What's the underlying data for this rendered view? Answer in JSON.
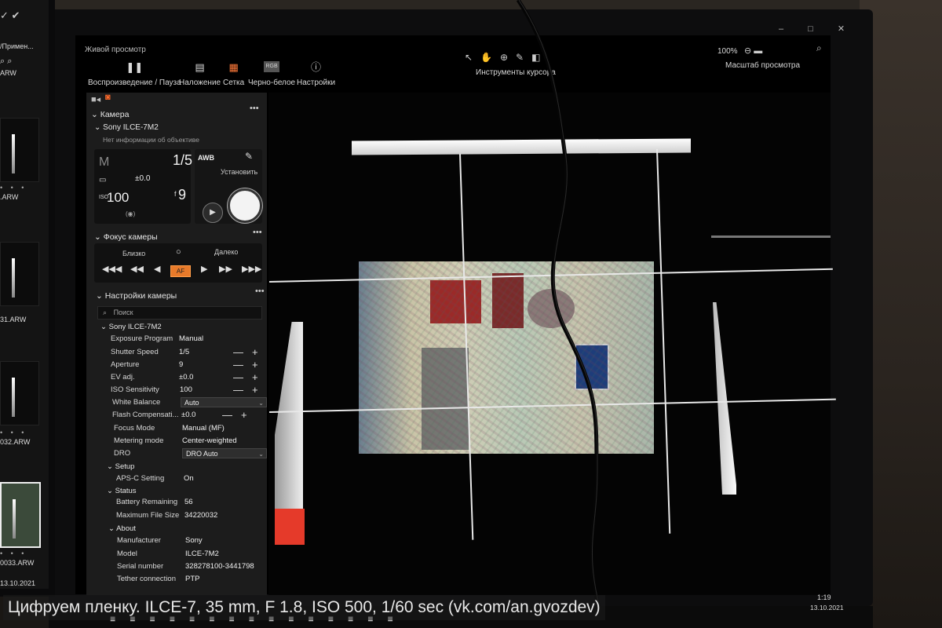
{
  "window": {
    "title": "Живой просмотр",
    "controls": "–  □  ✕"
  },
  "left_monitor": {
    "breadcrumb": "/Примен...",
    "files": [
      {
        "label": ".ARW"
      },
      {
        "label": "31.ARW"
      },
      {
        "label": "032.ARW"
      },
      {
        "label": "0033.ARW"
      }
    ],
    "footer_date": "13.10.2021"
  },
  "toolbar": {
    "play_pause": "Воспроизведение / Пауза",
    "overlay": "Наложение",
    "grid": "Сетка",
    "bw": "Черно-белое",
    "bw_badge": "RGB",
    "settings": "Настройки",
    "cursor_tools_label": "Инструменты курсора",
    "zoom_value": "100%",
    "zoom_label": "Масштаб просмотра"
  },
  "camera": {
    "section_title": "Камера",
    "model": "Sony ILCE-7M2",
    "lens_info": "Нет информации об объективе",
    "mode": "M",
    "shutter": "1/5",
    "ev": "±0.0",
    "iso_label": "ISO",
    "iso": "100",
    "aperture_prefix": "f",
    "aperture": "9",
    "wb": "AWB",
    "set_label": "Установить"
  },
  "focus": {
    "section_title": "Фокус камеры",
    "near": "Близко",
    "far": "Далеко",
    "af_label": "AF"
  },
  "settings": {
    "section_title": "Настройки камеры",
    "search_placeholder": "Поиск",
    "group_camera": "Sony ILCE-7M2",
    "rows": [
      {
        "name": "Exposure Program",
        "value": "Manual"
      },
      {
        "name": "Shutter Speed",
        "value": "1/5"
      },
      {
        "name": "Aperture",
        "value": "9"
      },
      {
        "name": "EV adj.",
        "value": "±0.0"
      },
      {
        "name": "ISO Sensitivity",
        "value": "100"
      },
      {
        "name": "White Balance",
        "value": "Auto"
      },
      {
        "name": "Flash Compensati...",
        "value": "±0.0"
      },
      {
        "name": "Focus Mode",
        "value": "Manual (MF)"
      },
      {
        "name": "Metering mode",
        "value": "Center-weighted"
      },
      {
        "name": "DRO",
        "value": "DRO Auto"
      }
    ],
    "group_setup": "Setup",
    "setup_rows": [
      {
        "name": "APS-C Setting",
        "value": "On"
      }
    ],
    "group_status": "Status",
    "status_rows": [
      {
        "name": "Battery Remaining",
        "value": "56"
      },
      {
        "name": "Maximum File Size",
        "value": "34220032"
      }
    ],
    "group_about": "About",
    "about_rows": [
      {
        "name": "Manufacturer",
        "value": "Sony"
      },
      {
        "name": "Model",
        "value": "ILCE-7M2"
      },
      {
        "name": "Serial number",
        "value": "328278100-3441798"
      },
      {
        "name": "Tether connection",
        "value": "PTP"
      }
    ]
  },
  "taskbar": {
    "time": "1:19",
    "date": "13.10.2021"
  },
  "caption": "Цифруем пленку. ILCE-7, 35 mm, F 1.8, ISO 500, 1/60 sec (vk.com/an.gvozdev)"
}
